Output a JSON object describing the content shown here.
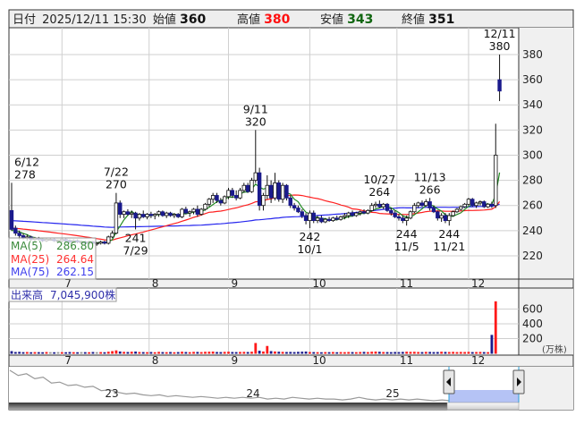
{
  "header": {
    "date_label": "日付",
    "date": "2025/12/11 15:30",
    "open_label": "始値",
    "open": "360",
    "high_label": "高値",
    "high": "380",
    "low_label": "安値",
    "low": "343",
    "close_label": "終値",
    "close": "351"
  },
  "legend": {
    "ma5_label": "MA(5)",
    "ma5_value": "286.80",
    "ma25_label": "MA(25)",
    "ma25_value": "264.64",
    "ma75_label": "MA(75)",
    "ma75_value": "262.15"
  },
  "volume_label": "出来高",
  "volume_value": "7,045,900株",
  "volume_unit": "(万株)",
  "navigator_labels": [
    "23",
    "24",
    "25"
  ],
  "colors": {
    "up_candle": "#ffffff",
    "down_candle": "#1a1a8c",
    "ma5": "#228b22",
    "ma25": "#ff2020",
    "ma75": "#2525ee",
    "vol_up": "#ff1a1a",
    "vol_down": "#1a1a8c",
    "vol_flat": "#999999"
  },
  "chart_data": {
    "type": "candlestick",
    "title": "",
    "price_ticks": [
      "220",
      "240",
      "260",
      "280",
      "300",
      "320",
      "340",
      "360",
      "380"
    ],
    "ylim": [
      220,
      380
    ],
    "volume_ticks": [
      "200",
      "400",
      "600"
    ],
    "volume_ylim": [
      0,
      750
    ],
    "month_labels": [
      {
        "label": "7",
        "day": 13
      },
      {
        "label": "8",
        "day": 35.5
      },
      {
        "label": "9",
        "day": 56
      },
      {
        "label": "10",
        "day": 77
      },
      {
        "label": "11",
        "day": 99.5
      },
      {
        "label": "12",
        "day": 118
      }
    ],
    "annotations": [
      {
        "date": "6/12",
        "value": "278",
        "day": 0,
        "kind": "high"
      },
      {
        "date": "7/22",
        "value": "270",
        "day": 27,
        "kind": "high"
      },
      {
        "date": "7/29",
        "value": "241",
        "day": 32,
        "kind": "low"
      },
      {
        "date": "9/11",
        "value": "320",
        "day": 63,
        "kind": "high"
      },
      {
        "date": "10/1",
        "value": "242",
        "day": 77,
        "kind": "low"
      },
      {
        "date": "10/27",
        "value": "264",
        "day": 95,
        "kind": "high"
      },
      {
        "date": "11/5",
        "value": "244",
        "day": 102,
        "kind": "low"
      },
      {
        "date": "11/13",
        "value": "266",
        "day": 108,
        "kind": "high"
      },
      {
        "date": "11/21",
        "value": "244",
        "day": 113,
        "kind": "low"
      },
      {
        "date": "12/11",
        "value": "380",
        "day": 126,
        "kind": "high"
      }
    ],
    "ohlc": [
      [
        256,
        278,
        240,
        241
      ],
      [
        242,
        244,
        236,
        238
      ],
      [
        238,
        240,
        233,
        236
      ],
      [
        236,
        238,
        233,
        234
      ],
      [
        234,
        237,
        232,
        235
      ],
      [
        235,
        236,
        232,
        233
      ],
      [
        233,
        235,
        231,
        234
      ],
      [
        234,
        235,
        232,
        233
      ],
      [
        233,
        234,
        231,
        232
      ],
      [
        232,
        234,
        231,
        233
      ],
      [
        233,
        234,
        232,
        233
      ],
      [
        233,
        234,
        231,
        232
      ],
      [
        232,
        233,
        231,
        232
      ],
      [
        232,
        234,
        231,
        233
      ],
      [
        233,
        234,
        231,
        232
      ],
      [
        232,
        233,
        230,
        231
      ],
      [
        231,
        233,
        230,
        232
      ],
      [
        232,
        233,
        230,
        231
      ],
      [
        231,
        232,
        229,
        231
      ],
      [
        231,
        232,
        229,
        230
      ],
      [
        230,
        232,
        229,
        231
      ],
      [
        231,
        232,
        229,
        230
      ],
      [
        230,
        231,
        228,
        230
      ],
      [
        230,
        232,
        229,
        231
      ],
      [
        231,
        232,
        229,
        230
      ],
      [
        230,
        236,
        229,
        235
      ],
      [
        235,
        240,
        234,
        238
      ],
      [
        238,
        270,
        237,
        262
      ],
      [
        262,
        264,
        250,
        253
      ],
      [
        253,
        256,
        250,
        255
      ],
      [
        255,
        257,
        252,
        253
      ],
      [
        253,
        256,
        250,
        254
      ],
      [
        254,
        255,
        241,
        250
      ],
      [
        250,
        254,
        248,
        253
      ],
      [
        253,
        256,
        250,
        251
      ],
      [
        251,
        254,
        249,
        253
      ],
      [
        253,
        255,
        250,
        252
      ],
      [
        252,
        254,
        249,
        253
      ],
      [
        253,
        256,
        251,
        255
      ],
      [
        255,
        256,
        251,
        252
      ],
      [
        252,
        255,
        250,
        254
      ],
      [
        254,
        255,
        251,
        252
      ],
      [
        252,
        254,
        250,
        253
      ],
      [
        253,
        254,
        250,
        251
      ],
      [
        251,
        258,
        250,
        257
      ],
      [
        257,
        259,
        253,
        254
      ],
      [
        254,
        256,
        251,
        255
      ],
      [
        255,
        258,
        253,
        257
      ],
      [
        257,
        260,
        251,
        253
      ],
      [
        253,
        258,
        252,
        257
      ],
      [
        257,
        262,
        256,
        261
      ],
      [
        261,
        266,
        259,
        265
      ],
      [
        265,
        270,
        262,
        268
      ],
      [
        268,
        270,
        262,
        264
      ],
      [
        264,
        266,
        260,
        262
      ],
      [
        262,
        268,
        261,
        267
      ],
      [
        267,
        274,
        265,
        272
      ],
      [
        272,
        274,
        266,
        268
      ],
      [
        268,
        272,
        264,
        266
      ],
      [
        266,
        274,
        265,
        272
      ],
      [
        272,
        278,
        270,
        276
      ],
      [
        276,
        278,
        270,
        271
      ],
      [
        271,
        282,
        270,
        280
      ],
      [
        280,
        320,
        278,
        286
      ],
      [
        286,
        290,
        256,
        260
      ],
      [
        260,
        270,
        256,
        268
      ],
      [
        268,
        284,
        265,
        276
      ],
      [
        276,
        280,
        262,
        266
      ],
      [
        266,
        286,
        264,
        278
      ],
      [
        278,
        280,
        263,
        265
      ],
      [
        265,
        278,
        262,
        276
      ],
      [
        276,
        277,
        264,
        266
      ],
      [
        266,
        268,
        258,
        260
      ],
      [
        260,
        262,
        256,
        258
      ],
      [
        258,
        260,
        254,
        255
      ],
      [
        255,
        257,
        250,
        252
      ],
      [
        252,
        254,
        245,
        248
      ],
      [
        248,
        256,
        242,
        254
      ],
      [
        254,
        256,
        246,
        248
      ],
      [
        248,
        252,
        246,
        250
      ],
      [
        250,
        252,
        246,
        247
      ],
      [
        247,
        250,
        246,
        249
      ],
      [
        249,
        251,
        247,
        248
      ],
      [
        248,
        251,
        247,
        250
      ],
      [
        250,
        252,
        248,
        249
      ],
      [
        249,
        252,
        248,
        251
      ],
      [
        251,
        254,
        249,
        252
      ],
      [
        252,
        255,
        250,
        254
      ],
      [
        254,
        256,
        251,
        252
      ],
      [
        252,
        255,
        251,
        254
      ],
      [
        254,
        256,
        252,
        255
      ],
      [
        255,
        257,
        253,
        254
      ],
      [
        254,
        257,
        253,
        256
      ],
      [
        256,
        262,
        255,
        260
      ],
      [
        260,
        263,
        258,
        261
      ],
      [
        261,
        264,
        258,
        259
      ],
      [
        259,
        262,
        257,
        261
      ],
      [
        261,
        262,
        255,
        256
      ],
      [
        256,
        258,
        252,
        254
      ],
      [
        254,
        256,
        250,
        251
      ],
      [
        251,
        253,
        248,
        250
      ],
      [
        250,
        252,
        246,
        248
      ],
      [
        248,
        252,
        244,
        250
      ],
      [
        250,
        256,
        249,
        255
      ],
      [
        255,
        262,
        254,
        260
      ],
      [
        260,
        263,
        258,
        262
      ],
      [
        262,
        264,
        259,
        260
      ],
      [
        260,
        265,
        259,
        263
      ],
      [
        263,
        266,
        256,
        258
      ],
      [
        258,
        260,
        254,
        255
      ],
      [
        255,
        256,
        248,
        250
      ],
      [
        250,
        254,
        247,
        252
      ],
      [
        252,
        254,
        246,
        248
      ],
      [
        248,
        254,
        244,
        252
      ],
      [
        252,
        256,
        251,
        255
      ],
      [
        255,
        258,
        254,
        257
      ],
      [
        257,
        260,
        256,
        259
      ],
      [
        259,
        262,
        258,
        261
      ],
      [
        261,
        266,
        260,
        265
      ],
      [
        265,
        266,
        259,
        260
      ],
      [
        260,
        263,
        258,
        262
      ],
      [
        262,
        264,
        260,
        263
      ],
      [
        263,
        264,
        258,
        259
      ],
      [
        259,
        262,
        258,
        261
      ],
      [
        261,
        263,
        258,
        260
      ],
      [
        260,
        325,
        258,
        300
      ],
      [
        360,
        380,
        343,
        351
      ]
    ],
    "volume": [
      30,
      18,
      20,
      16,
      18,
      15,
      17,
      16,
      15,
      18,
      16,
      15,
      17,
      16,
      15,
      18,
      16,
      15,
      17,
      16,
      15,
      18,
      16,
      17,
      15,
      22,
      30,
      40,
      25,
      20,
      18,
      22,
      24,
      18,
      17,
      16,
      18,
      15,
      20,
      17,
      16,
      18,
      15,
      17,
      22,
      18,
      16,
      20,
      19,
      17,
      21,
      22,
      24,
      18,
      17,
      20,
      22,
      18,
      17,
      19,
      20,
      18,
      22,
      140,
      35,
      25,
      100,
      30,
      25,
      22,
      20,
      18,
      19,
      17,
      20,
      22,
      24,
      18,
      17,
      16,
      15,
      17,
      16,
      18,
      15,
      17,
      16,
      18,
      17,
      16,
      18,
      20,
      17,
      22,
      24,
      21,
      18,
      17,
      16,
      18,
      17,
      19,
      22,
      20,
      21,
      18,
      17,
      20,
      19,
      17,
      18,
      22,
      19,
      18,
      20,
      17,
      19,
      18,
      20,
      17,
      18,
      19,
      17,
      16,
      250,
      705
    ],
    "navigator_series": [
      300,
      294,
      296,
      290,
      292,
      285,
      286,
      282,
      283,
      280,
      281,
      276,
      277,
      274,
      272,
      273,
      271,
      270,
      271,
      269,
      270,
      269,
      268,
      269,
      268,
      267,
      268,
      267,
      268,
      267,
      268,
      266,
      267,
      266,
      268,
      267,
      266,
      267,
      266,
      266,
      265,
      266,
      268,
      266,
      265,
      266,
      265,
      266,
      265,
      266,
      265,
      264,
      265,
      264,
      265,
      266,
      265,
      264,
      265,
      266,
      270,
      272
    ]
  }
}
